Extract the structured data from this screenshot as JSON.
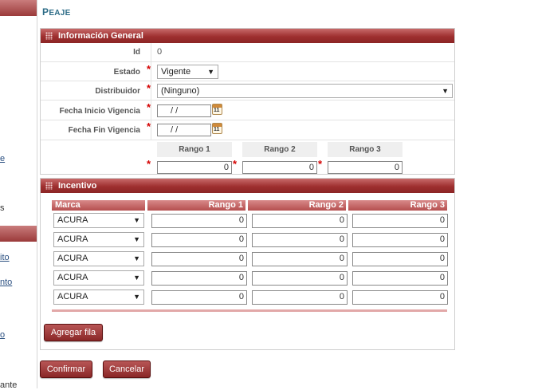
{
  "page": {
    "title_cap": "P",
    "title_rest": "EAJE"
  },
  "sidebar": {
    "links": [
      "e",
      "ito",
      "nto",
      "o"
    ],
    "texts": [
      "s",
      "ante"
    ]
  },
  "general": {
    "header": "Información General",
    "id_label": "Id",
    "id_value": "0",
    "estado_label": "Estado",
    "estado_value": "Vigente",
    "distribuidor_label": "Distribuidor",
    "distribuidor_value": "(Ninguno)",
    "fecha_inicio_label": "Fecha Inicio Vigencia",
    "fecha_inicio_value": "/ /",
    "fecha_fin_label": "Fecha Fin Vigencia",
    "fecha_fin_value": "/ /",
    "calendar_icon_text": "11",
    "rango_headers": [
      "Rango 1",
      "Rango 2",
      "Rango 3"
    ],
    "rango_values": [
      "0",
      "0",
      "0"
    ],
    "required_mark": "*"
  },
  "incentivo": {
    "header": "Incentivo",
    "columns": [
      "Marca",
      "Rango 1",
      "Rango 2",
      "Rango 3"
    ],
    "rows": [
      {
        "marca": "ACURA",
        "r1": "0",
        "r2": "0",
        "r3": "0"
      },
      {
        "marca": "ACURA",
        "r1": "0",
        "r2": "0",
        "r3": "0"
      },
      {
        "marca": "ACURA",
        "r1": "0",
        "r2": "0",
        "r3": "0"
      },
      {
        "marca": "ACURA",
        "r1": "0",
        "r2": "0",
        "r3": "0"
      },
      {
        "marca": "ACURA",
        "r1": "0",
        "r2": "0",
        "r3": "0"
      }
    ],
    "add_row_label": "Agregar fila"
  },
  "actions": {
    "confirm_label": "Confirmar",
    "cancel_label": "Cancelar"
  },
  "colors": {
    "accent": "#9e2f2f",
    "title": "#2b6b86"
  },
  "icons": {
    "dropdown": "chevron-down-icon",
    "calendar": "calendar-icon",
    "grip": "grip-icon"
  }
}
